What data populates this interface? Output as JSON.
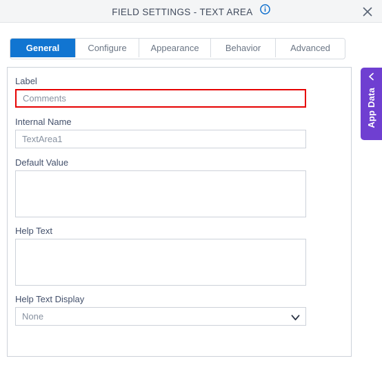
{
  "header": {
    "title": "FIELD SETTINGS - TEXT AREA",
    "info_icon": "info-circle-icon",
    "close_icon": "close-icon"
  },
  "tabs": [
    {
      "label": "General",
      "active": true
    },
    {
      "label": "Configure",
      "active": false
    },
    {
      "label": "Appearance",
      "active": false
    },
    {
      "label": "Behavior",
      "active": false
    },
    {
      "label": "Advanced",
      "active": false
    }
  ],
  "form": {
    "label_field": {
      "label": "Label",
      "value": "Comments",
      "error": true
    },
    "internal_name_field": {
      "label": "Internal Name",
      "value": "TextArea1"
    },
    "default_value_field": {
      "label": "Default Value",
      "value": ""
    },
    "help_text_field": {
      "label": "Help Text",
      "value": ""
    },
    "help_text_display_field": {
      "label": "Help Text Display",
      "value": "None",
      "options": [
        "None"
      ],
      "chevron_icon": "chevron-down-icon"
    }
  },
  "side_panel": {
    "label": "App Data",
    "chevron_icon": "chevron-left-icon"
  },
  "colors": {
    "accent_blue": "#1175d1",
    "error_red": "#e60000",
    "app_data_purple": "#6f3fd1",
    "header_bg": "#f4f5f6",
    "border_gray": "#ccd1d9",
    "label_text": "#43506b",
    "input_text": "#8791a0"
  }
}
